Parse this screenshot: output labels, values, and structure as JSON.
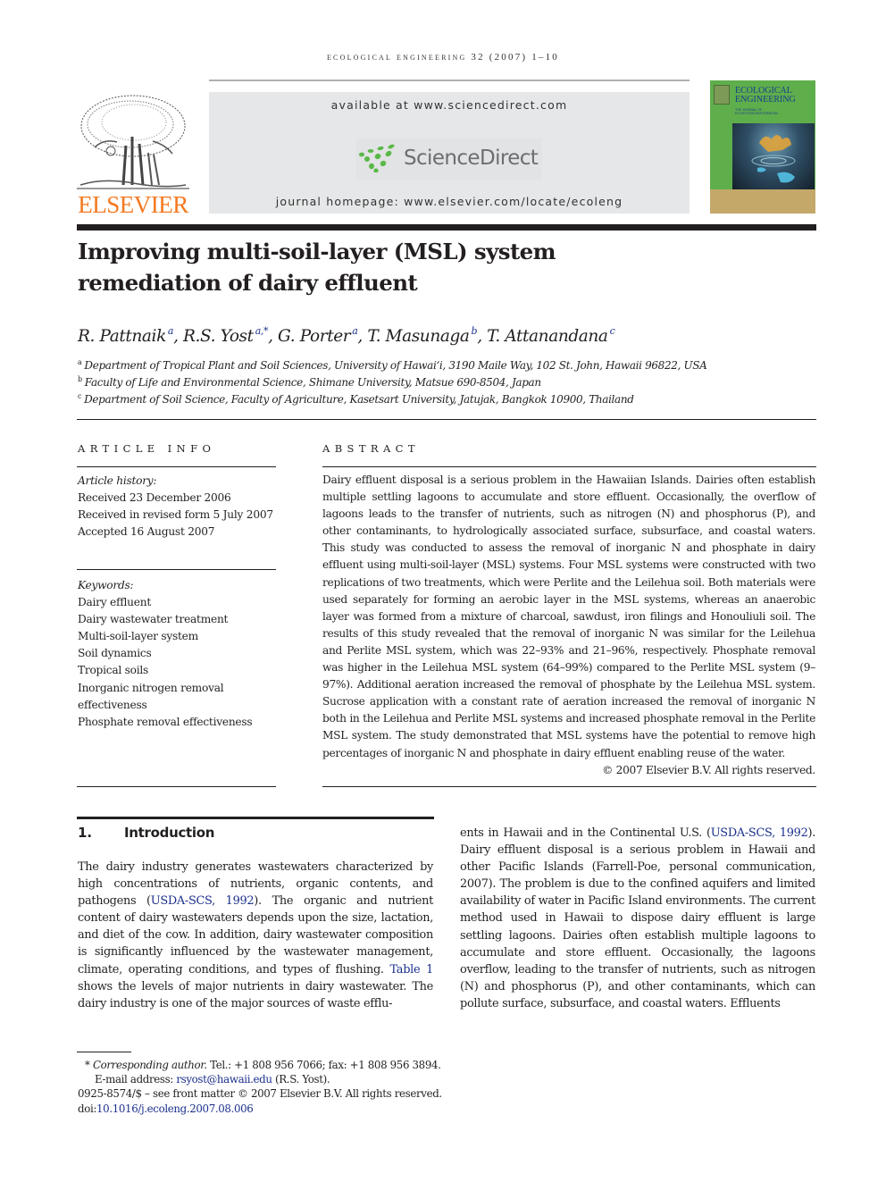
{
  "header": {
    "running_head": "ECOLOGICAL ENGINEERING 32 (2007) 1–10",
    "publisher_logo": "ELSEVIER",
    "available_at": "available at www.sciencedirect.com",
    "sciencedirect_logo": "ScienceDirect",
    "journal_homepage": "journal homepage: www.elsevier.com/locate/ecoleng",
    "cover": {
      "title_line1": "ECOLOGICAL",
      "title_line2": "ENGINEERING",
      "subtitle_line1": "THE JOURNAL OF",
      "subtitle_line2": "ECOSYSTEM RESTORATION"
    },
    "colors": {
      "elsevier_orange": "#f47920",
      "sciencedirect_green": "#59b947",
      "link_blue": "#1a2f8c",
      "banner_gray": "#e6e7e8"
    }
  },
  "article": {
    "title_line1": "Improving multi-soil-layer (MSL) system",
    "title_line2": "remediation of dairy effluent",
    "authors": [
      {
        "name": "R. Pattnaik",
        "sup": "a"
      },
      {
        "name": "R.S. Yost",
        "sup": "a,*"
      },
      {
        "name": "G. Porter",
        "sup": "a"
      },
      {
        "name": "T. Masunaga",
        "sup": "b"
      },
      {
        "name": "T. Attanandana",
        "sup": "c"
      }
    ],
    "affiliations": [
      {
        "key": "a",
        "text": "Department of Tropical Plant and Soil Sciences, University of Hawai‘i, 3190 Maile Way, 102 St. John, Hawaii 96822, USA"
      },
      {
        "key": "b",
        "text": "Faculty of Life and Environmental Science, Shimane University, Matsue 690-8504, Japan"
      },
      {
        "key": "c",
        "text": "Department of Soil Science, Faculty of Agriculture, Kasetsart University, Jatujak, Bangkok 10900, Thailand"
      }
    ]
  },
  "article_info": {
    "heading": "ARTICLE INFO",
    "history_label": "Article history:",
    "history": [
      "Received 23 December 2006",
      "Received in revised form 5 July 2007",
      "Accepted 16 August 2007"
    ],
    "keywords_label": "Keywords:",
    "keywords": [
      "Dairy effluent",
      "Dairy wastewater treatment",
      "Multi-soil-layer system",
      "Soil dynamics",
      "Tropical soils",
      "Inorganic nitrogen removal effectiveness",
      "Phosphate removal effectiveness"
    ]
  },
  "abstract": {
    "heading": "ABSTRACT",
    "text": "Dairy effluent disposal is a serious problem in the Hawaiian Islands. Dairies often establish multiple settling lagoons to accumulate and store effluent. Occasionally, the overflow of lagoons leads to the transfer of nutrients, such as nitrogen (N) and phosphorus (P), and other contaminants, to hydrologically associated surface, subsurface, and coastal waters. This study was conducted to assess the removal of inorganic N and phosphate in dairy effluent using multi-soil-layer (MSL) systems. Four MSL systems were constructed with two replications of two treatments, which were Perlite and the Leilehua soil. Both materials were used separately for forming an aerobic layer in the MSL systems, whereas an anaerobic layer was formed from a mixture of charcoal, sawdust, iron filings and Honouliuli soil. The results of this study revealed that the removal of inorganic N was similar for the Leilehua and Perlite MSL system, which was 22–93% and 21–96%, respectively. Phosphate removal was higher in the Leilehua MSL system (64–99%) compared to the Perlite MSL system (9–97%). Additional aeration increased the removal of phosphate by the Leilehua MSL system. Sucrose application with a constant rate of aeration increased the removal of inorganic N both in the Leilehua and Perlite MSL systems and increased phosphate removal in the Perlite MSL system. The study demonstrated that MSL systems have the potential to remove high percentages of inorganic N and phosphate in dairy effluent enabling reuse of the water.",
    "copyright": "© 2007 Elsevier B.V. All rights reserved."
  },
  "introduction": {
    "number": "1.",
    "title": "Introduction",
    "col1": {
      "p1_a": "The dairy industry generates wastewaters characterized by high concentrations of nutrients, organic contents, and pathogens (",
      "p1_cite1": "USDA-SCS, 1992",
      "p1_b": "). The organic and nutrient content of dairy wastewaters depends upon the size, lactation, and diet of the cow. In addition, dairy wastewater composition is significantly influenced by the wastewater management, climate, operating conditions, and types of flushing. ",
      "p1_table": "Table 1",
      "p1_c": " shows the levels of major nutrients in dairy wastewater. The dairy industry is one of the major sources of waste efflu-"
    },
    "col2": {
      "p1_a": "ents in Hawaii and in the Continental U.S. (",
      "p1_cite": "USDA-SCS, 1992",
      "p1_b": "). Dairy effluent disposal is a serious problem in Hawaii and other Pacific Islands (Farrell-Poe, personal communication, 2007). The problem is due to the confined aquifers and limited availability of water in Pacific Island environments. The current method used in Hawaii to dispose dairy effluent is large settling lagoons. Dairies often establish multiple lagoons to accumulate and store effluent. Occasionally, the lagoons overflow, leading to the transfer of nutrients, such as nitrogen (N) and phosphorus (P), and other contaminants, which can pollute surface, subsurface, and coastal waters. Effluents"
    }
  },
  "footnotes": {
    "star": "*",
    "corresponding_label": "Corresponding author.",
    "phone_fax": " Tel.: +1 808 956 7066; fax: +1 808 956 3894.",
    "email_label": "E-mail address: ",
    "email": "rsyost@hawaii.edu",
    "email_suffix": " (R.S. Yost).",
    "issn_line": "0925-8574/$ – see front matter © 2007 Elsevier B.V. All rights reserved.",
    "doi_label": "doi:",
    "doi": "10.1016/j.ecoleng.2007.08.006"
  }
}
